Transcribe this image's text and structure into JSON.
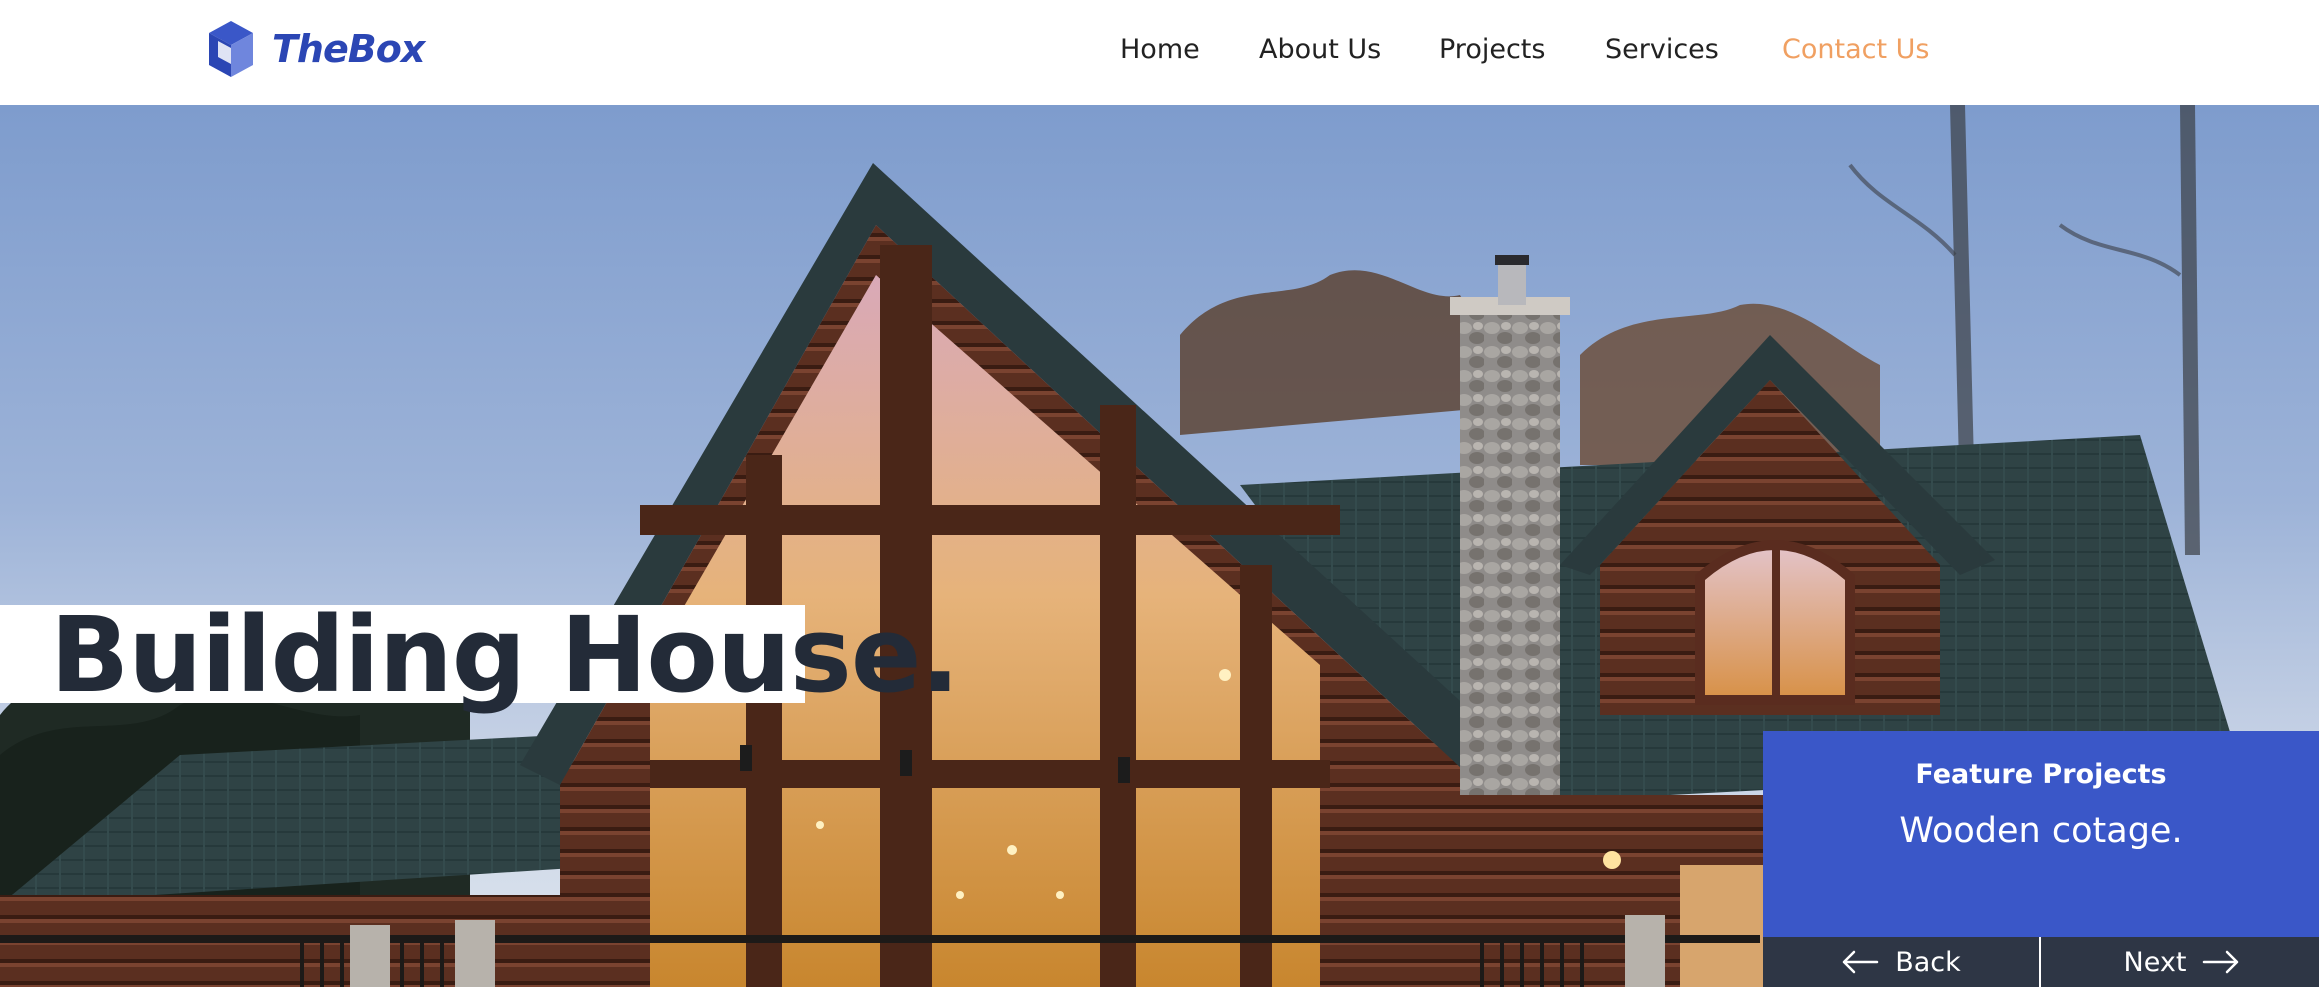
{
  "header": {
    "logo_text": "TheBox",
    "logo_icon": "cube-icon",
    "nav": [
      {
        "label": "Home"
      },
      {
        "label": "About Us"
      },
      {
        "label": "Projects"
      },
      {
        "label": "Services"
      },
      {
        "label": "Contact Us",
        "active": true
      }
    ]
  },
  "hero": {
    "headline": "Building House.",
    "image": "log-cabin-house-at-dusk"
  },
  "feature": {
    "label": "Feature Projects",
    "title": "Wooden cotage."
  },
  "pager": {
    "back_label": "Back",
    "next_label": "Next",
    "back_icon": "arrow-left-icon",
    "next_icon": "arrow-right-icon"
  },
  "colors": {
    "brand": "#2b46b4",
    "accent": "#f0a062",
    "feature_bg": "#3a57c8",
    "pager_bg": "#2e3645",
    "headline_text": "#232b38"
  }
}
